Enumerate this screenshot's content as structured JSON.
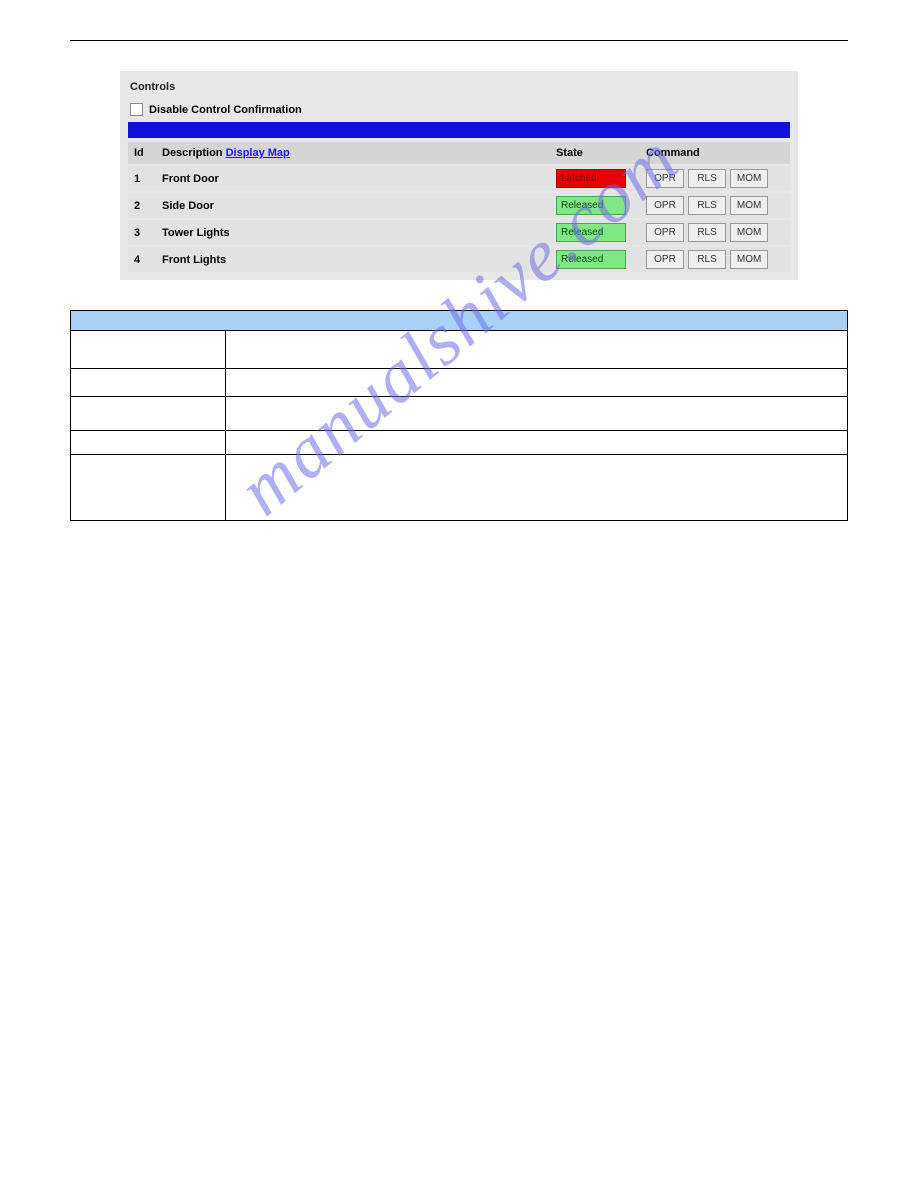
{
  "controls": {
    "title": "Controls",
    "disable_label": "Disable Control Confirmation",
    "headers": {
      "id": "Id",
      "description": "Description",
      "display_map": "Display Map",
      "state": "State",
      "command": "Command"
    },
    "buttons": {
      "opr": "OPR",
      "rls": "RLS",
      "mom": "MOM"
    },
    "states": {
      "latched": "Latched",
      "released": "Released"
    },
    "rows": [
      {
        "id": "1",
        "description": "Front Door",
        "state": "latched"
      },
      {
        "id": "2",
        "description": "Side Door",
        "state": "released"
      },
      {
        "id": "3",
        "description": "Tower Lights",
        "state": "released"
      },
      {
        "id": "4",
        "description": "Front Lights",
        "state": "released"
      }
    ]
  },
  "watermark": "manualshive.com"
}
